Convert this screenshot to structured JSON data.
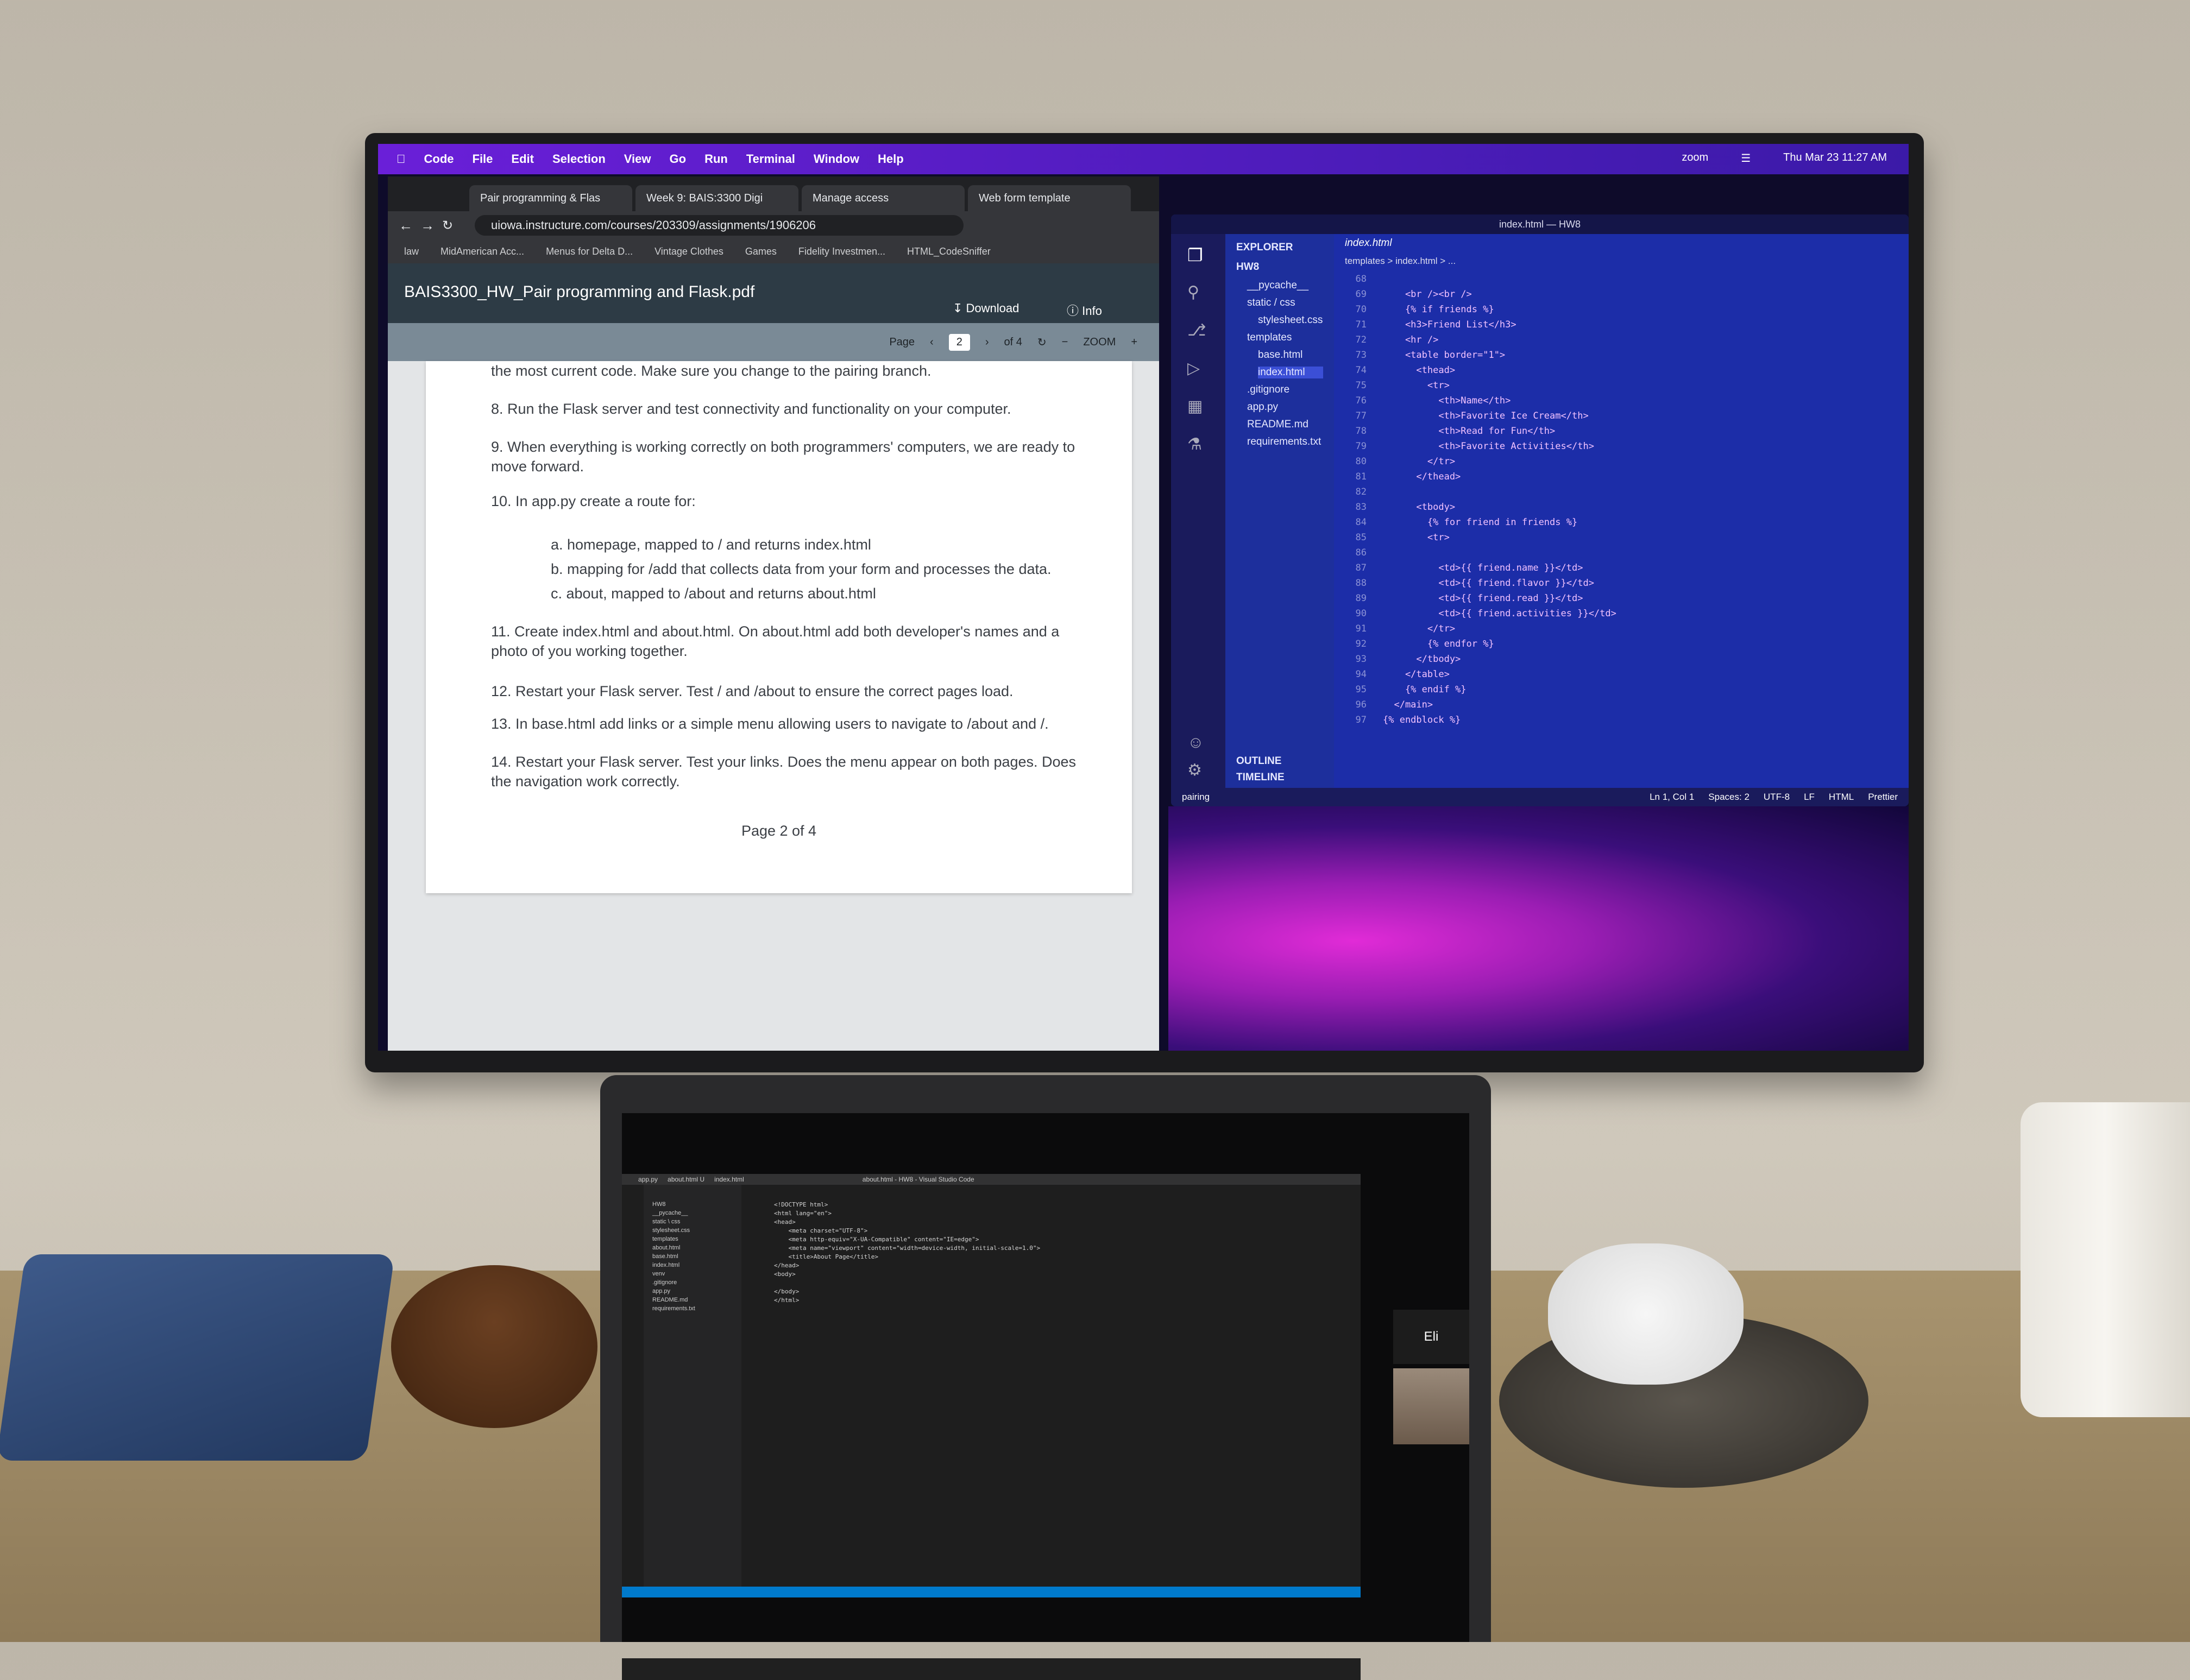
{
  "menubar": {
    "app": "Code",
    "items": [
      "File",
      "Edit",
      "Selection",
      "View",
      "Go",
      "Run",
      "Terminal",
      "Window",
      "Help"
    ],
    "status": [
      "zoom",
      "Thu Mar 23 11:27 AM"
    ]
  },
  "browser": {
    "tabs": [
      "Pair programming & Flas",
      "Week 9: BAIS:3300 Digi",
      "Manage access",
      "Web form template"
    ],
    "url": "uiowa.instructure.com/courses/203309/assignments/1906206",
    "bookmarks": [
      "law",
      "MidAmerican Acc...",
      "Menus for Delta D...",
      "Vintage Clothes",
      "Games",
      "Fidelity Investmen...",
      "HTML_CodeSniffer"
    ],
    "pdf_title": "BAIS3300_HW_Pair programming and Flask.pdf",
    "download": "Download",
    "info": "Info",
    "page_label": "Page",
    "page_num": "2",
    "page_of": "of 4",
    "zoom_label": "ZOOM"
  },
  "pdf": {
    "line0": "the most current code. Make sure you change to the pairing branch.",
    "s8": "8.   Run the Flask server and test connectivity and functionality on your computer.",
    "s9": "9.   When everything is working correctly on both programmers' computers, we are ready to move forward.",
    "s10": "10. In app.py create a route for:",
    "a": "a.   homepage, mapped to / and returns index.html",
    "b": "b.   mapping for /add that collects data from your form and processes the data.",
    "c": "c.   about, mapped to /about and returns about.html",
    "s11": "11. Create index.html and about.html. On about.html add both developer's names and a photo of you working together.",
    "s12": "12. Restart your Flask server. Test / and /about to ensure the correct pages load.",
    "s13": "13. In base.html add links or a simple menu allowing users to navigate to /about and /.",
    "s14": "14. Restart your Flask server. Test your links. Does the menu appear on both pages. Does the navigation work correctly.",
    "footer": "Page 2 of 4"
  },
  "vscode": {
    "title": "index.html — HW8",
    "explorer_label": "EXPLORER",
    "folder": "HW8",
    "files": [
      "__pycache__",
      "static / css",
      "stylesheet.css",
      "templates",
      "base.html",
      "index.html",
      ".gitignore",
      "app.py",
      "README.md",
      "requirements.txt"
    ],
    "tab": "index.html",
    "breadcrumb": "templates > index.html > ...",
    "outline": "OUTLINE",
    "timeline": "TIMELINE",
    "branch": "pairing",
    "status_right": [
      "Ln 1, Col 1",
      "Spaces: 2",
      "UTF-8",
      "LF",
      "HTML",
      "Prettier"
    ],
    "lines": [
      {
        "n": "68",
        "t": ""
      },
      {
        "n": "69",
        "t": "    <br /><br />"
      },
      {
        "n": "70",
        "t": "    {% if friends %}"
      },
      {
        "n": "71",
        "t": "    <h3>Friend List</h3>"
      },
      {
        "n": "72",
        "t": "    <hr />"
      },
      {
        "n": "73",
        "t": "    <table border=\"1\">"
      },
      {
        "n": "74",
        "t": "      <thead>"
      },
      {
        "n": "75",
        "t": "        <tr>"
      },
      {
        "n": "76",
        "t": "          <th>Name</th>"
      },
      {
        "n": "77",
        "t": "          <th>Favorite Ice Cream</th>"
      },
      {
        "n": "78",
        "t": "          <th>Read for Fun</th>"
      },
      {
        "n": "79",
        "t": "          <th>Favorite Activities</th>"
      },
      {
        "n": "80",
        "t": "        </tr>"
      },
      {
        "n": "81",
        "t": "      </thead>"
      },
      {
        "n": "82",
        "t": ""
      },
      {
        "n": "83",
        "t": "      <tbody>"
      },
      {
        "n": "84",
        "t": "        {% for friend in friends %}"
      },
      {
        "n": "85",
        "t": "        <tr>"
      },
      {
        "n": "86",
        "t": ""
      },
      {
        "n": "87",
        "t": "          <td>{{ friend.name }}</td>"
      },
      {
        "n": "88",
        "t": "          <td>{{ friend.flavor }}</td>"
      },
      {
        "n": "89",
        "t": "          <td>{{ friend.read }}</td>"
      },
      {
        "n": "90",
        "t": "          <td>{{ friend.activities }}</td>"
      },
      {
        "n": "91",
        "t": "        </tr>"
      },
      {
        "n": "92",
        "t": "        {% endfor %}"
      },
      {
        "n": "93",
        "t": "      </tbody>"
      },
      {
        "n": "94",
        "t": "    </table>"
      },
      {
        "n": "95",
        "t": "    {% endif %}"
      },
      {
        "n": "96",
        "t": "  </main>"
      },
      {
        "n": "97",
        "t": "{% endblock %}"
      }
    ]
  },
  "laptop": {
    "title": "about.html - HW8 - Visual Studio Code",
    "tabs": [
      "app.py",
      "about.html U",
      "index.html"
    ],
    "files": [
      "HW8",
      "__pycache__",
      "static \\ css",
      "stylesheet.css",
      "templates",
      "about.html",
      "base.html",
      "index.html",
      "venv",
      ".gitignore",
      "app.py",
      "README.md",
      "requirements.txt"
    ],
    "code": [
      "<!DOCTYPE html>",
      "<html lang=\"en\">",
      "<head>",
      "    <meta charset=\"UTF-8\">",
      "    <meta http-equiv=\"X-UA-Compatible\" content=\"IE=edge\">",
      "    <meta name=\"viewport\" content=\"width=device-width, initial-scale=1.0\">",
      "    <title>About Page</title>",
      "</head>",
      "<body>",
      "",
      "</body>",
      "</html>"
    ],
    "zoom_participant": "Eli"
  }
}
